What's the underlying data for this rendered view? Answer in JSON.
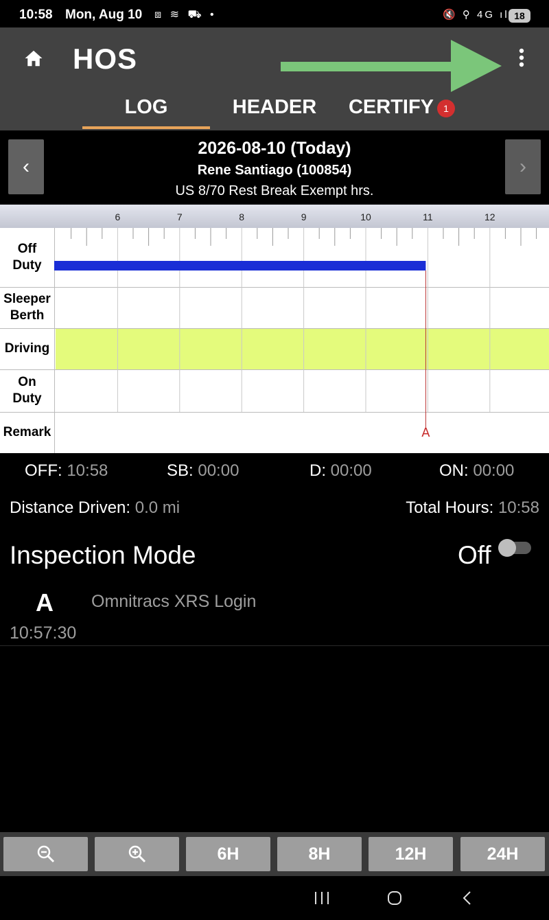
{
  "status_bar": {
    "time": "10:58",
    "date": "Mon, Aug 10",
    "left_icons": "⧈ ≋ ⛟ •",
    "right_icons": "🔇 ⚲ 4G ıl",
    "battery": "18"
  },
  "app_bar": {
    "title": "HOS",
    "tabs": [
      {
        "label": "LOG",
        "selected": true
      },
      {
        "label": "HEADER",
        "selected": false
      },
      {
        "label": "CERTIFY",
        "selected": false,
        "badge": "1"
      }
    ],
    "accent_color": "#e8a45a"
  },
  "log_header": {
    "date": "2026-08-10 (Today)",
    "driver": "Rene  Santiago (100854)",
    "ruleset": "US 8/70 Rest Break Exempt hrs.",
    "prev_label": "‹",
    "next_label": "›"
  },
  "graph": {
    "hour_labels": [
      "6",
      "7",
      "8",
      "9",
      "10",
      "11",
      "12"
    ],
    "rows": [
      "Off Duty",
      "Sleeper Berth",
      "Driving",
      "On Duty",
      "Remark"
    ],
    "remark_marker": "A",
    "off_duty_color": "#1a2ed6",
    "driving_row_color": "#e4fb7c"
  },
  "totals": {
    "off_label": "OFF:",
    "off_value": "10:58",
    "sb_label": "SB:",
    "sb_value": "00:00",
    "d_label": "D:",
    "d_value": "00:00",
    "on_label": "ON:",
    "on_value": "00:00",
    "distance_label": "Distance Driven:",
    "distance_value": "0.0 mi",
    "total_label": "Total Hours:",
    "total_value": "10:58"
  },
  "inspection": {
    "label": "Inspection Mode",
    "state": "Off",
    "enabled": false
  },
  "events": [
    {
      "code": "A",
      "description": "Omnitracs XRS Login",
      "time": "10:57:30"
    }
  ],
  "zoom_bar": {
    "buttons": [
      "zoom-out-icon",
      "zoom-in-icon",
      "6H",
      "8H",
      "12H",
      "24H"
    ]
  }
}
